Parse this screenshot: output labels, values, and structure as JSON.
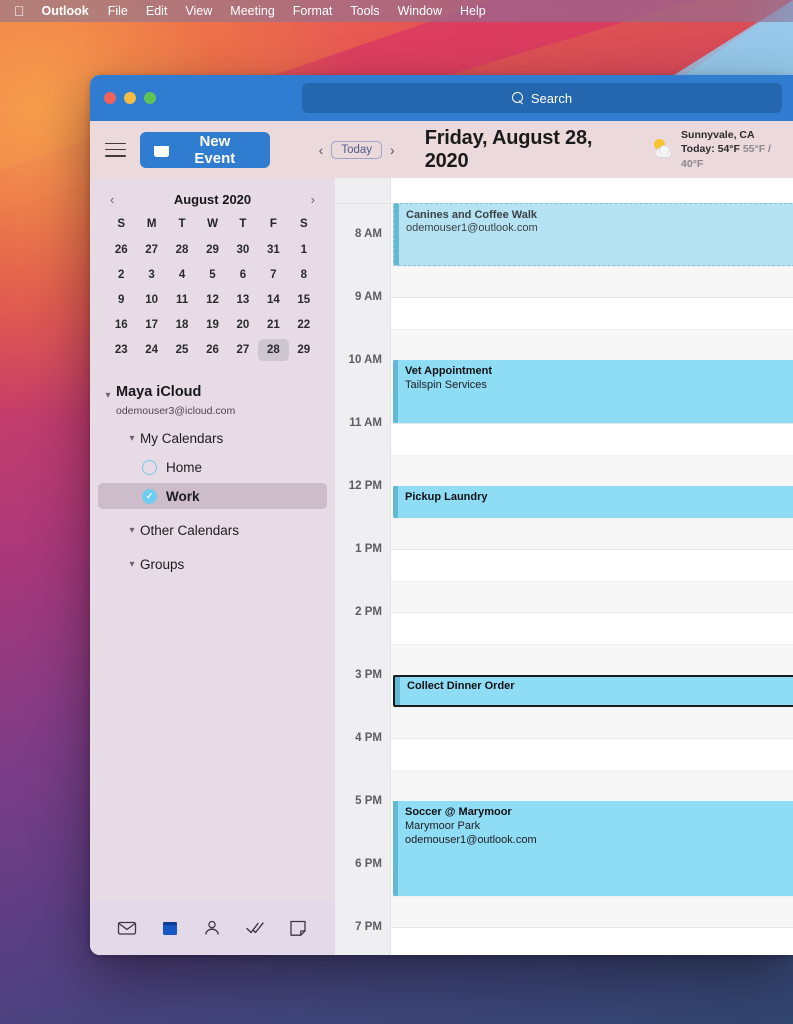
{
  "menubar": {
    "apple_icon": "apple-logo-icon",
    "items": [
      "Outlook",
      "File",
      "Edit",
      "View",
      "Meeting",
      "Format",
      "Tools",
      "Window",
      "Help"
    ]
  },
  "window": {
    "traffic_lights": [
      "close",
      "minimize",
      "zoom"
    ],
    "search": {
      "placeholder": "Search",
      "icon": "search-icon"
    }
  },
  "toolbar": {
    "menu_icon": "hamburger-icon",
    "new_event_label": "New Event",
    "new_event_icon": "calendar-icon",
    "prev_label": "‹",
    "today_label": "Today",
    "next_label": "›",
    "date_title": "Friday, August 28, 2020",
    "weather": {
      "icon": "sun-behind-cloud-icon",
      "location": "Sunnyvale, CA",
      "today_temp": "Today: 54°F",
      "range": "55°F / 40°F"
    }
  },
  "sidebar": {
    "mini_calendar": {
      "prev_icon": "chevron-left-icon",
      "next_icon": "chevron-right-icon",
      "title": "August 2020",
      "dow": [
        "S",
        "M",
        "T",
        "W",
        "T",
        "F",
        "S"
      ],
      "weeks": [
        [
          "26",
          "27",
          "28",
          "29",
          "30",
          "31",
          "1"
        ],
        [
          "2",
          "3",
          "4",
          "5",
          "6",
          "7",
          "8"
        ],
        [
          "9",
          "10",
          "11",
          "12",
          "13",
          "14",
          "15"
        ],
        [
          "16",
          "17",
          "18",
          "19",
          "20",
          "21",
          "22"
        ],
        [
          "23",
          "24",
          "25",
          "26",
          "27",
          "28",
          "29"
        ]
      ],
      "today": "28"
    },
    "account": {
      "name": "Maya iCloud",
      "email": "odemouser3@icloud.com",
      "chevron": "chevron-down-icon"
    },
    "groups": [
      {
        "label": "My Calendars",
        "expanded": true
      },
      {
        "label": "Other Calendars",
        "expanded": true
      },
      {
        "label": "Groups",
        "expanded": true
      }
    ],
    "calendars": [
      {
        "label": "Home",
        "checked": false,
        "selected": false
      },
      {
        "label": "Work",
        "checked": true,
        "selected": true
      }
    ],
    "bottom_nav": [
      {
        "name": "mail-icon",
        "label": "Mail",
        "active": false
      },
      {
        "name": "calendar-icon",
        "label": "Calendar",
        "active": true
      },
      {
        "name": "people-icon",
        "label": "People",
        "active": false
      },
      {
        "name": "tasks-icon",
        "label": "Tasks",
        "active": false
      },
      {
        "name": "notes-icon",
        "label": "Notes",
        "active": false
      }
    ]
  },
  "calendar": {
    "hours": [
      "8 AM",
      "9 AM",
      "10 AM",
      "11 AM",
      "12 PM",
      "1 PM",
      "2 PM",
      "3 PM",
      "4 PM",
      "5 PM",
      "6 PM",
      "7 PM"
    ],
    "events": [
      {
        "title": "Canines and Coffee Walk",
        "lines": [
          "odemouser1@outlook.com"
        ],
        "start_hour": "7:30 AM",
        "end_hour": "8:30 AM",
        "state": "tentative",
        "selected": false
      },
      {
        "title": "Vet Appointment",
        "lines": [
          "Tailspin Services"
        ],
        "start_hour": "10 AM",
        "end_hour": "11 AM",
        "state": "busy",
        "selected": false
      },
      {
        "title": "Pickup Laundry",
        "lines": [],
        "start_hour": "12 PM",
        "end_hour": "12:30 PM",
        "state": "busy",
        "selected": false
      },
      {
        "title": "Collect Dinner Order",
        "lines": [],
        "start_hour": "3 PM",
        "end_hour": "3:30 PM",
        "state": "busy",
        "selected": true
      },
      {
        "title": "Soccer @ Marymoor",
        "lines": [
          "Marymoor Park",
          "odemouser1@outlook.com"
        ],
        "start_hour": "5 PM",
        "end_hour": "6:30 PM",
        "state": "busy",
        "selected": false
      }
    ]
  },
  "colors": {
    "accent": "#2f7cd1",
    "event": "#8fdcf5",
    "event_bar": "#63b8d4",
    "sidebar": "#e7dbe6",
    "toolbar": "#ecd9db"
  }
}
